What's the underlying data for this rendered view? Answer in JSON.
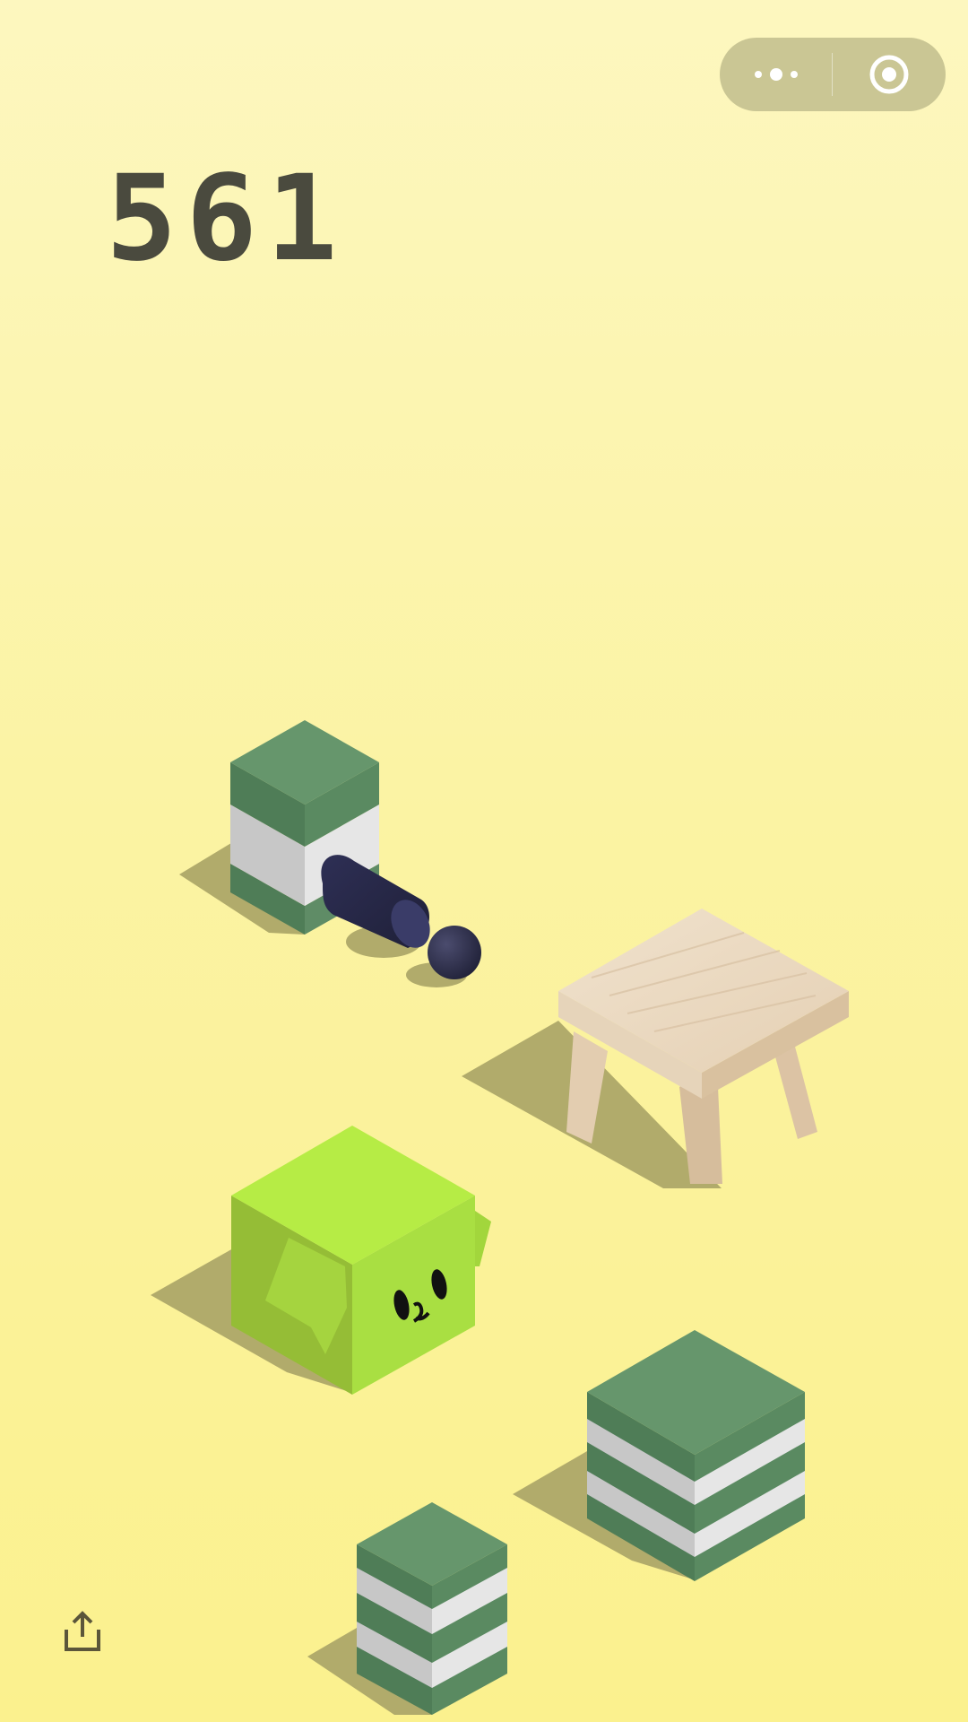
{
  "game": {
    "score": "561"
  },
  "capsule": {
    "more_icon": "more-dots-icon",
    "close_icon": "target-close-icon"
  },
  "share": {
    "icon": "share-upload-icon"
  },
  "colors": {
    "background_top": "#fdf7bf",
    "background_bottom": "#fbf18e",
    "score_text": "#4a4a3e",
    "capsule_bg": "#cac694",
    "player_green": "#b6ec45",
    "block_green": "#62946a",
    "block_white": "#e2e2e2",
    "wood": "#ead7bd",
    "cannon": "#2a2b48"
  }
}
